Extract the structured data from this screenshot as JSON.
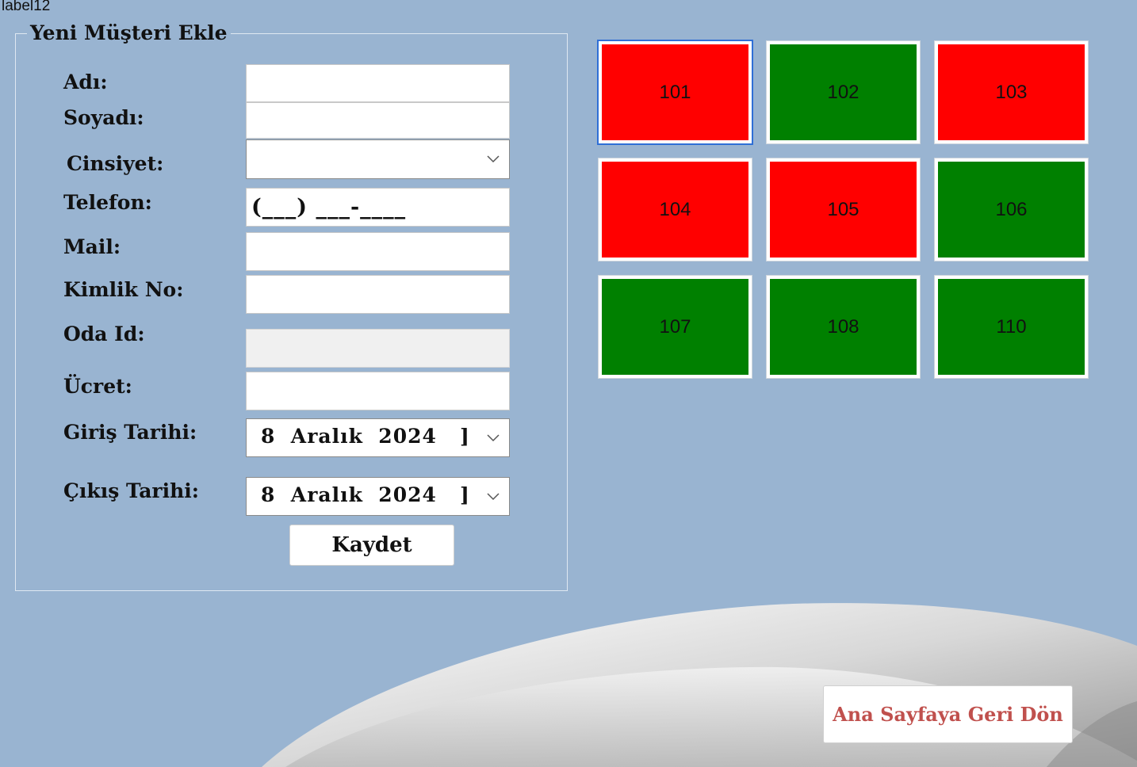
{
  "corner_label": "label12",
  "form": {
    "title": "Yeni Müşteri Ekle",
    "labels": {
      "first_name": "Adı:",
      "last_name": "Soyadı:",
      "gender": "Cinsiyet:",
      "phone": "Telefon:",
      "mail": "Mail:",
      "id_number": "Kimlik No:",
      "room_id": "Oda Id:",
      "price": "Ücret:",
      "checkin": "Giriş Tarihi:",
      "checkout": "Çıkış Tarihi:"
    },
    "values": {
      "first_name": "",
      "last_name": "",
      "gender": "",
      "phone_mask": "(___) ___-____",
      "mail": "",
      "id_number": "",
      "room_id": "",
      "price": "",
      "checkin_date": "8  Aralık  2024   ]",
      "checkout_date": "8  Aralık  2024   ]"
    },
    "save_label": "Kaydet"
  },
  "rooms": [
    {
      "number": "101",
      "status": "occupied",
      "color": "#ff0000"
    },
    {
      "number": "102",
      "status": "available",
      "color": "#008000"
    },
    {
      "number": "103",
      "status": "occupied",
      "color": "#ff0000"
    },
    {
      "number": "104",
      "status": "occupied",
      "color": "#ff0000"
    },
    {
      "number": "105",
      "status": "occupied",
      "color": "#ff0000"
    },
    {
      "number": "106",
      "status": "available",
      "color": "#008000"
    },
    {
      "number": "107",
      "status": "available",
      "color": "#008000"
    },
    {
      "number": "108",
      "status": "available",
      "color": "#008000"
    },
    {
      "number": "110",
      "status": "available",
      "color": "#008000"
    }
  ],
  "back_button_label": "Ana Sayfaya Geri Dön",
  "colors": {
    "background": "#99b4d1",
    "occupied": "#ff0000",
    "available": "#008000",
    "back_button_text": "#c0504d"
  }
}
